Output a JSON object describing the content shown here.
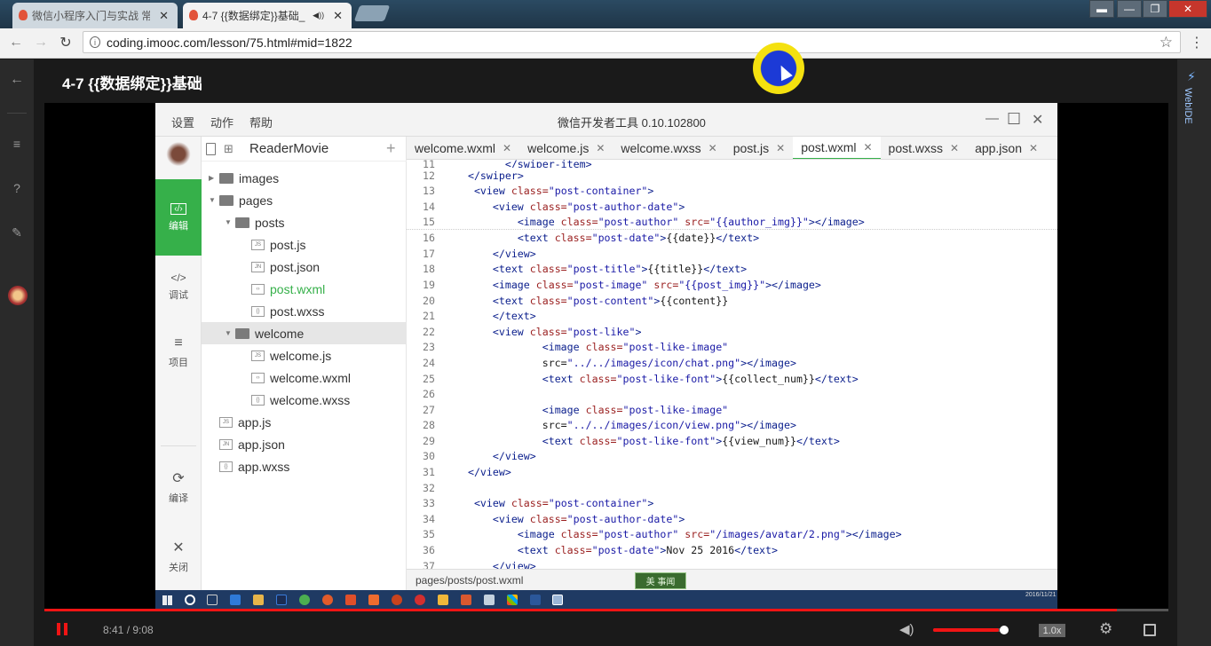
{
  "browser": {
    "tabs": [
      {
        "title": "微信小程序入门与实战 常",
        "close": "✕"
      },
      {
        "title": "4-7 {{数据绑定}}基础_",
        "close": "✕",
        "audio": "◀))"
      }
    ],
    "url": "coding.imooc.com/lesson/75.html#mid=1822",
    "nav_back": "←",
    "nav_forward": "→",
    "reload": "↻",
    "star": "☆",
    "menu": "⋮",
    "win_controls": [
      "▬",
      "—",
      "❐",
      "✕"
    ]
  },
  "page": {
    "back_icon": "←",
    "lesson_title": "4-7 {{数据绑定}}基础",
    "right_rail_label": "WebIDE"
  },
  "devtools": {
    "menu": [
      "设置",
      "动作",
      "帮助"
    ],
    "title": "微信开发者工具 0.10.102800",
    "window_buttons": [
      "—",
      "☐",
      "✕"
    ],
    "project_name": "ReaderMovie",
    "add": "+",
    "sidebar": [
      {
        "label": "编辑",
        "icon": "‹/›",
        "active": true
      },
      {
        "label": "调试",
        "icon": "</>"
      },
      {
        "label": "项目",
        "icon": "≡"
      },
      {
        "label": "编译",
        "icon": "⟳"
      },
      {
        "label": "关闭",
        "icon": "✕"
      }
    ],
    "tree": [
      {
        "label": "images",
        "type": "dir",
        "indent": 0
      },
      {
        "label": "pages",
        "type": "dir",
        "indent": 0,
        "open": true
      },
      {
        "label": "posts",
        "type": "dir",
        "indent": 1,
        "open": true
      },
      {
        "label": "post.js",
        "type": "file",
        "icon": "JS",
        "indent": 2
      },
      {
        "label": "post.json",
        "type": "file",
        "icon": "JN",
        "indent": 2
      },
      {
        "label": "post.wxml",
        "type": "file",
        "icon": "‹›",
        "indent": 2,
        "green": true
      },
      {
        "label": "post.wxss",
        "type": "file",
        "icon": "{}",
        "indent": 2
      },
      {
        "label": "welcome",
        "type": "dir",
        "indent": 1,
        "open": true,
        "selected": true
      },
      {
        "label": "welcome.js",
        "type": "file",
        "icon": "JS",
        "indent": 2
      },
      {
        "label": "welcome.wxml",
        "type": "file",
        "icon": "‹›",
        "indent": 2
      },
      {
        "label": "welcome.wxss",
        "type": "file",
        "icon": "{}",
        "indent": 2
      },
      {
        "label": "app.js",
        "type": "file",
        "icon": "JS",
        "indent": 0
      },
      {
        "label": "app.json",
        "type": "file",
        "icon": "JN",
        "indent": 0
      },
      {
        "label": "app.wxss",
        "type": "file",
        "icon": "{}",
        "indent": 0
      }
    ],
    "editor_tabs": [
      {
        "label": "welcome.wxml"
      },
      {
        "label": "welcome.js"
      },
      {
        "label": "welcome.wxss"
      },
      {
        "label": "post.js"
      },
      {
        "label": "post.wxml",
        "active": true
      },
      {
        "label": "post.wxss"
      },
      {
        "label": "app.json"
      }
    ],
    "tab_close": "✕",
    "code_lines": [
      {
        "n": "11",
        "t": "</swiper-item>",
        "i": "        "
      },
      {
        "n": "12",
        "t": "</swiper>",
        "i": "  "
      },
      {
        "n": "13",
        "t": "<view class=\"post-container\">",
        "i": "   "
      },
      {
        "n": "14",
        "t": "<view class=\"post-author-date\">",
        "i": "      "
      },
      {
        "n": "15",
        "t": "<image class=\"post-author\" src=\"{{author_img}}\"></image>",
        "i": "          "
      },
      {
        "n": "16",
        "t": "<text class=\"post-date\">{{date}}</text>",
        "i": "          "
      },
      {
        "n": "17",
        "t": "</view>",
        "i": "      "
      },
      {
        "n": "18",
        "t": "<text class=\"post-title\">{{title}}</text>",
        "i": "      "
      },
      {
        "n": "19",
        "t": "<image class=\"post-image\" src=\"{{post_img}}\"></image>",
        "i": "      "
      },
      {
        "n": "20",
        "t": "<text class=\"post-content\">{{content}}",
        "i": "      "
      },
      {
        "n": "21",
        "t": "</text>",
        "i": "      "
      },
      {
        "n": "22",
        "t": "<view class=\"post-like\">",
        "i": "      "
      },
      {
        "n": "23",
        "t": "<image class=\"post-like-image\"",
        "i": "              "
      },
      {
        "n": "24",
        "t": "src=\"../../images/icon/chat.png\"></image>",
        "i": "              "
      },
      {
        "n": "25",
        "t": "<text class=\"post-like-font\">{{collect_num}}</text>",
        "i": "              "
      },
      {
        "n": "26",
        "t": "",
        "i": ""
      },
      {
        "n": "27",
        "t": "<image class=\"post-like-image\"",
        "i": "              "
      },
      {
        "n": "28",
        "t": "src=\"../../images/icon/view.png\"></image>",
        "i": "              "
      },
      {
        "n": "29",
        "t": "<text class=\"post-like-font\">{{view_num}}</text>",
        "i": "              "
      },
      {
        "n": "30",
        "t": "</view>",
        "i": "      "
      },
      {
        "n": "31",
        "t": "</view>",
        "i": "  "
      },
      {
        "n": "32",
        "t": "",
        "i": ""
      },
      {
        "n": "33",
        "t": "<view class=\"post-container\">",
        "i": "   "
      },
      {
        "n": "34",
        "t": "<view class=\"post-author-date\">",
        "i": "      "
      },
      {
        "n": "35",
        "t": "<image class=\"post-author\" src=\"/images/avatar/2.png\"></image>",
        "i": "          "
      },
      {
        "n": "36",
        "t": "<text class=\"post-date\">Nov 25 2016</text>",
        "i": "          "
      },
      {
        "n": "37",
        "t": "</view>",
        "i": "      "
      }
    ],
    "status_path": "pages/posts/post.wxml",
    "watermark": "美 事闻",
    "taskbar_clock": "2016/11/21"
  },
  "player": {
    "pause_icon": "pause",
    "time": "8:41 / 9:08",
    "progress": 0.954,
    "volume_icon": "🔊",
    "volume": 0.93,
    "speed": "1.0x",
    "settings_icon": "⚙",
    "fullscreen_icon": "⛶"
  },
  "colors": {
    "accent": "#f01414",
    "wx_green": "#36b04a"
  }
}
